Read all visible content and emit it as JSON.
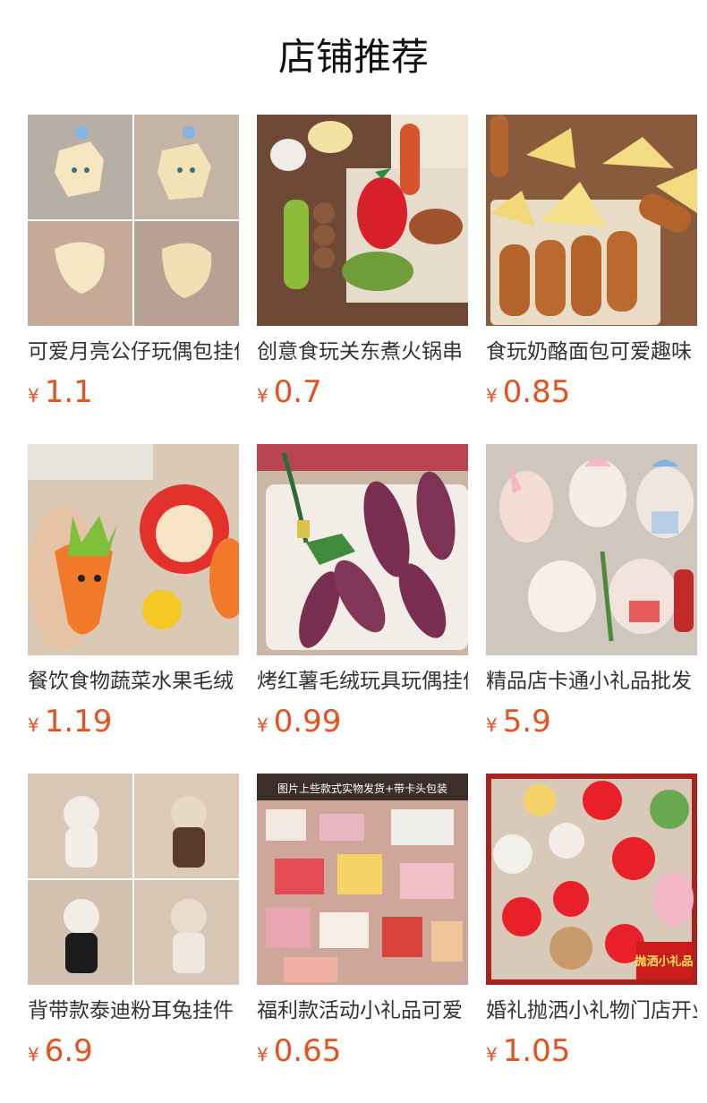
{
  "page_title": "店铺推荐",
  "currency_symbol": "¥",
  "colors": {
    "price": "#e8501e"
  },
  "products": [
    {
      "name": "可爱月亮公仔玩偶包挂件",
      "price": "1.1",
      "image": "plush-star-moon-keychains"
    },
    {
      "name": "创意食玩关东煮火锅串",
      "price": "0.7",
      "image": "food-plush-skewers-chili"
    },
    {
      "name": "食玩奶酪面包可爱趣味",
      "price": "0.85",
      "image": "cheese-bread-plush"
    },
    {
      "name": "餐饮食物蔬菜水果毛绒",
      "price": "1.19",
      "image": "carrot-apple-plush"
    },
    {
      "name": "烤红薯毛绒玩具玩偶挂件",
      "price": "0.99",
      "image": "sweet-potato-plush"
    },
    {
      "name": "精品店卡通小礼品批发",
      "price": "5.9",
      "image": "bunny-plush-bows"
    },
    {
      "name": "背带款泰迪粉耳兔挂件",
      "price": "6.9",
      "image": "teddy-bunny-overalls"
    },
    {
      "name": "福利款活动小礼品可爱",
      "price": "0.65",
      "image": "assorted-gift-bags",
      "image_text": "图片上些款式实物发货+带卡头包装"
    },
    {
      "name": "婚礼抛洒小礼物门店开业",
      "price": "1.05",
      "image": "wedding-gift-plush",
      "image_text": "抛洒小礼品"
    }
  ]
}
